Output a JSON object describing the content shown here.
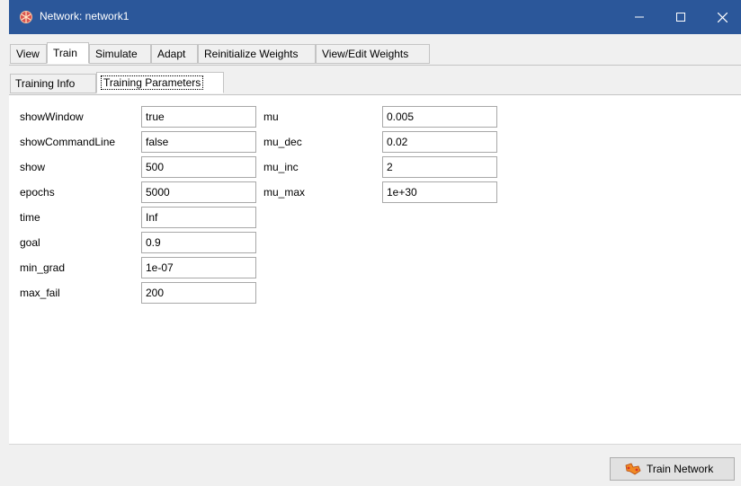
{
  "window": {
    "title": "Network: network1",
    "minimize_glyph": "—",
    "maximize_glyph": "☐",
    "close_glyph": "✕"
  },
  "menu_tabs": [
    {
      "label": "View"
    },
    {
      "label": "Train"
    },
    {
      "label": "Simulate"
    },
    {
      "label": "Adapt"
    },
    {
      "label": "Reinitialize Weights"
    },
    {
      "label": "View/Edit Weights"
    }
  ],
  "sub_tabs": [
    {
      "label": "Training Info"
    },
    {
      "label": "Training Parameters"
    }
  ],
  "params_left": [
    {
      "name": "showWindow",
      "value": "true"
    },
    {
      "name": "showCommandLine",
      "value": "false"
    },
    {
      "name": "show",
      "value": "500"
    },
    {
      "name": "epochs",
      "value": "5000"
    },
    {
      "name": "time",
      "value": "Inf"
    },
    {
      "name": "goal",
      "value": "0.9"
    },
    {
      "name": "min_grad",
      "value": "1e-07"
    },
    {
      "name": "max_fail",
      "value": "200"
    }
  ],
  "params_right": [
    {
      "name": "mu",
      "value": "0.005"
    },
    {
      "name": "mu_dec",
      "value": "0.02"
    },
    {
      "name": "mu_inc",
      "value": "2"
    },
    {
      "name": "mu_max",
      "value": "1e+30"
    }
  ],
  "train_button": {
    "label": "Train Network",
    "icon": "network-icon"
  },
  "colors": {
    "titlebar": "#2b579a",
    "window_bg": "#f0f0f0"
  }
}
